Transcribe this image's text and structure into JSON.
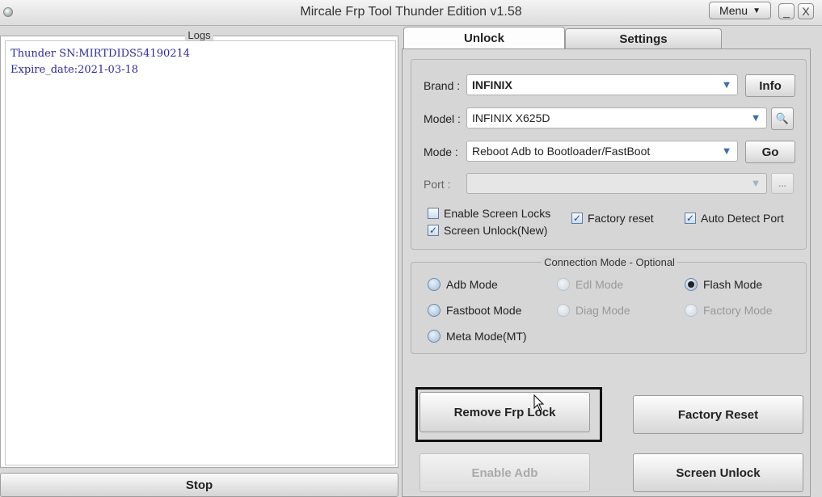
{
  "window": {
    "title": "Mircale Frp Tool Thunder Edition v1.58",
    "menu_label": "Menu",
    "minimize": "_",
    "close": "X"
  },
  "logs": {
    "title": "Logs",
    "lines": [
      "Thunder SN:MIRTDIDS54190214",
      "Expire_date:2021-03-18"
    ]
  },
  "stop_label": "Stop",
  "tabs": [
    {
      "label": "Unlock",
      "active": true
    },
    {
      "label": "Settings",
      "active": false
    }
  ],
  "form": {
    "brand_label": "Brand :",
    "brand_value": "INFINIX",
    "info_label": "Info",
    "model_label": "Model :",
    "model_value": "INFINIX X625D",
    "mode_label": "Mode :",
    "mode_value": "Reboot Adb to Bootloader/FastBoot",
    "go_label": "Go",
    "port_label": "Port :",
    "port_value": "",
    "port_btn": "..."
  },
  "checks": [
    {
      "label": "Enable Screen Locks",
      "checked": false
    },
    {
      "label": "Screen Unlock(New)",
      "checked": true
    },
    {
      "label": "Factory reset",
      "checked": true
    },
    {
      "label": "Auto Detect Port",
      "checked": true
    }
  ],
  "connection": {
    "title": "Connection Mode - Optional",
    "modes": [
      {
        "label": "Adb Mode",
        "selected": false,
        "enabled": true
      },
      {
        "label": "Edl Mode",
        "selected": false,
        "enabled": false
      },
      {
        "label": "Flash Mode",
        "selected": true,
        "enabled": true
      },
      {
        "label": "Fastboot Mode",
        "selected": false,
        "enabled": true
      },
      {
        "label": "Diag Mode",
        "selected": false,
        "enabled": false
      },
      {
        "label": "Factory Mode",
        "selected": false,
        "enabled": false
      },
      {
        "label": "Meta Mode(MT)",
        "selected": false,
        "enabled": true
      }
    ]
  },
  "actions": {
    "remove_frp": "Remove Frp Lock",
    "factory_reset": "Factory Reset",
    "enable_adb": "Enable Adb",
    "screen_unlock": "Screen Unlock"
  },
  "colors": {
    "log_text": "#2a2aa0",
    "accent_arrow": "#3a6fb0"
  }
}
